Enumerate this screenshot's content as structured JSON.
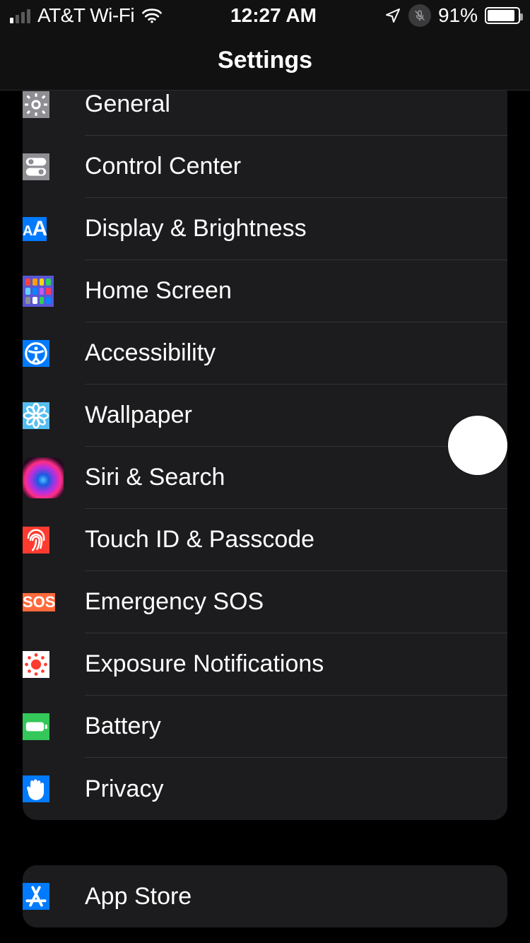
{
  "status": {
    "carrier": "AT&T Wi-Fi",
    "time": "12:27 AM",
    "battery_pct": "91%",
    "battery_fill": 91
  },
  "header": {
    "title": "Settings"
  },
  "groups": [
    {
      "rows": [
        {
          "key": "general",
          "label": "General",
          "icon": "gear",
          "bg": "bg-gray"
        },
        {
          "key": "controlcenter",
          "label": "Control Center",
          "icon": "toggles",
          "bg": "bg-gray"
        },
        {
          "key": "display",
          "label": "Display & Brightness",
          "icon": "AA",
          "bg": "bg-blue"
        },
        {
          "key": "homescreen",
          "label": "Home Screen",
          "icon": "grid",
          "bg": "bg-indigo"
        },
        {
          "key": "accessibility",
          "label": "Accessibility",
          "icon": "person",
          "bg": "bg-blue"
        },
        {
          "key": "wallpaper",
          "label": "Wallpaper",
          "icon": "flower",
          "bg": "bg-cyan"
        },
        {
          "key": "siri",
          "label": "Siri & Search",
          "icon": "siri",
          "bg": "bg-black"
        },
        {
          "key": "touchid",
          "label": "Touch ID & Passcode",
          "icon": "fingerprint",
          "bg": "bg-red"
        },
        {
          "key": "sos",
          "label": "Emergency SOS",
          "icon": "SOS",
          "bg": "bg-orange"
        },
        {
          "key": "exposure",
          "label": "Exposure Notifications",
          "icon": "exposure",
          "bg": "bg-white"
        },
        {
          "key": "battery",
          "label": "Battery",
          "icon": "battery",
          "bg": "bg-green"
        },
        {
          "key": "privacy",
          "label": "Privacy",
          "icon": "hand",
          "bg": "bg-blue"
        }
      ]
    },
    {
      "rows": [
        {
          "key": "appstore",
          "label": "App Store",
          "icon": "appstore",
          "bg": "bg-blue"
        }
      ]
    }
  ]
}
